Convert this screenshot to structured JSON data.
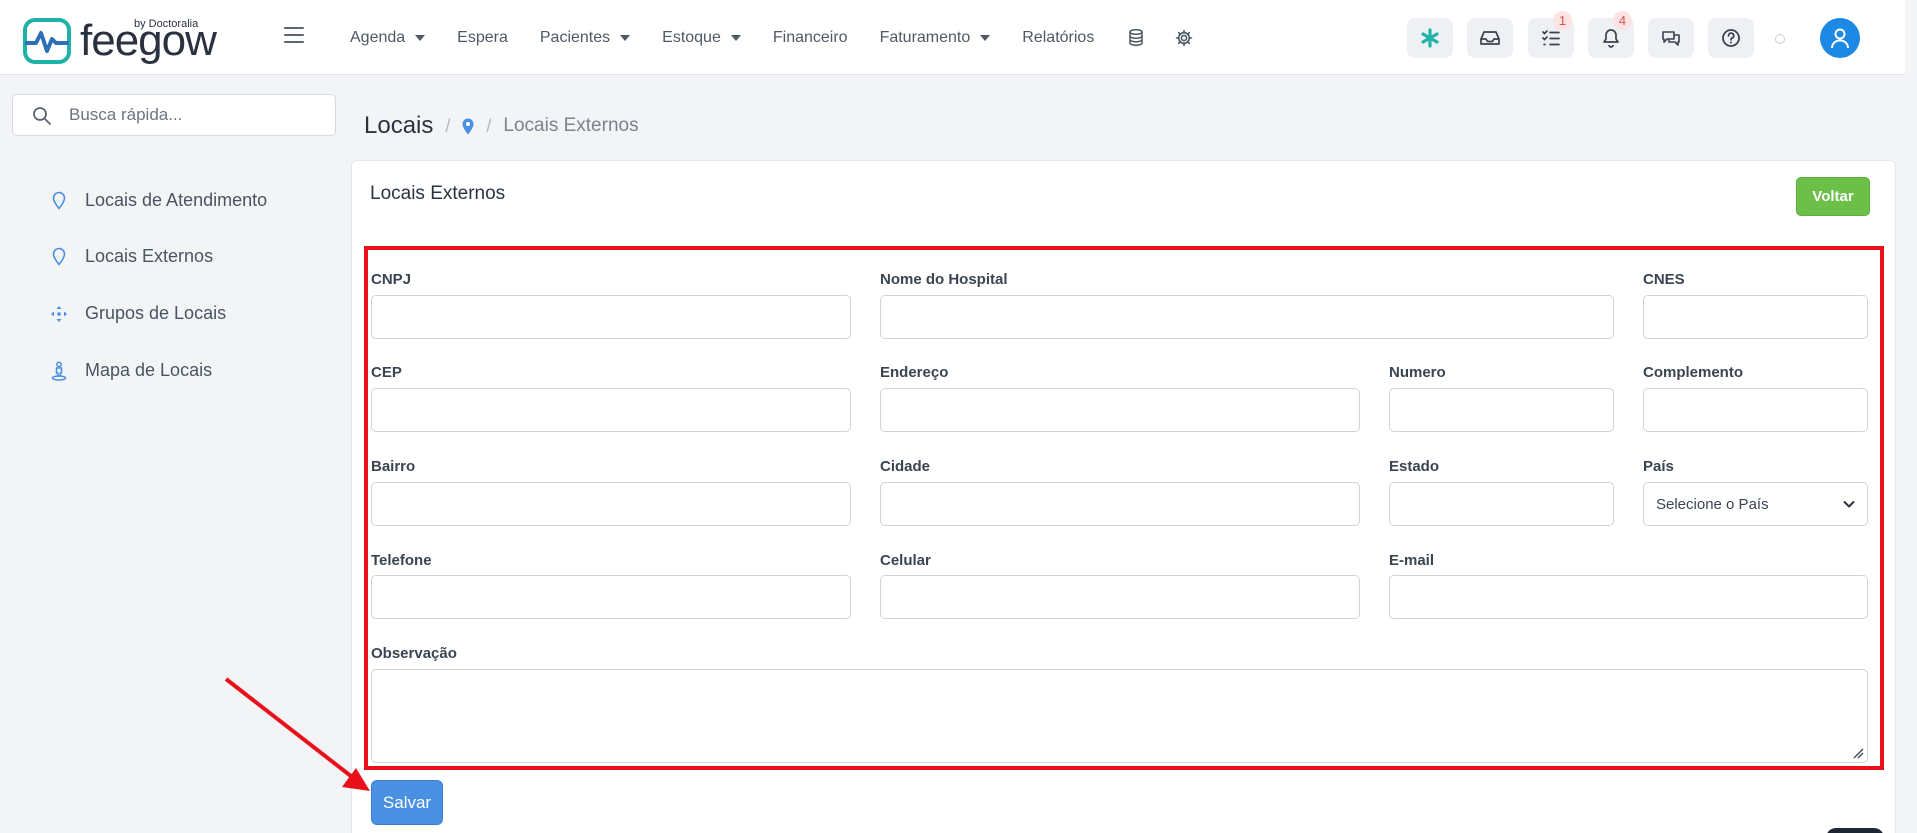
{
  "header": {
    "brand": "feegow",
    "brand_by": "by Doctoralia",
    "nav": [
      {
        "label": "Agenda",
        "dropdown": true
      },
      {
        "label": "Espera",
        "dropdown": false
      },
      {
        "label": "Pacientes",
        "dropdown": true
      },
      {
        "label": "Estoque",
        "dropdown": true
      },
      {
        "label": "Financeiro",
        "dropdown": false
      },
      {
        "label": "Faturamento",
        "dropdown": true
      },
      {
        "label": "Relatórios",
        "dropdown": false
      }
    ],
    "nav_icons": [
      "database-icon",
      "gear-icon"
    ],
    "toolbar": [
      {
        "icon": "asterisk-icon",
        "badge": ""
      },
      {
        "icon": "inbox-icon",
        "badge": ""
      },
      {
        "icon": "checklist-icon",
        "badge": "1"
      },
      {
        "icon": "bell-icon",
        "badge": "4"
      },
      {
        "icon": "chat-icon",
        "badge": ""
      },
      {
        "icon": "help-icon",
        "badge": ""
      }
    ],
    "brand_colors": {
      "accent": "#1eb3a6",
      "avatar": "#1e88e5"
    }
  },
  "sidebar": {
    "search_placeholder": "Busca rápida...",
    "items": [
      {
        "label": "Locais de Atendimento",
        "icon": "map-pin-icon"
      },
      {
        "label": "Locais Externos",
        "icon": "map-pin-icon"
      },
      {
        "label": "Grupos de Locais",
        "icon": "crosshair-icon"
      },
      {
        "label": "Mapa de Locais",
        "icon": "street-view-icon"
      }
    ]
  },
  "breadcrumb": {
    "title": "Locais",
    "current": "Locais Externos"
  },
  "card": {
    "title": "Locais Externos",
    "back_button": "Voltar",
    "save_button": "Salvar",
    "fields": {
      "cnpj": {
        "label": "CNPJ",
        "value": ""
      },
      "hospital": {
        "label": "Nome do Hospital",
        "value": ""
      },
      "cnes": {
        "label": "CNES",
        "value": ""
      },
      "cep": {
        "label": "CEP",
        "value": ""
      },
      "endereco": {
        "label": "Endereço",
        "value": ""
      },
      "numero": {
        "label": "Numero",
        "value": ""
      },
      "complemento": {
        "label": "Complemento",
        "value": ""
      },
      "bairro": {
        "label": "Bairro",
        "value": ""
      },
      "cidade": {
        "label": "Cidade",
        "value": ""
      },
      "estado": {
        "label": "Estado",
        "value": ""
      },
      "pais": {
        "label": "País",
        "selected": "Selecione o País"
      },
      "telefone": {
        "label": "Telefone",
        "value": ""
      },
      "celular": {
        "label": "Celular",
        "value": ""
      },
      "email": {
        "label": "E-mail",
        "value": ""
      },
      "observacao": {
        "label": "Observação",
        "value": ""
      }
    }
  },
  "annotations": {
    "highlight_color": "#e8111b"
  }
}
